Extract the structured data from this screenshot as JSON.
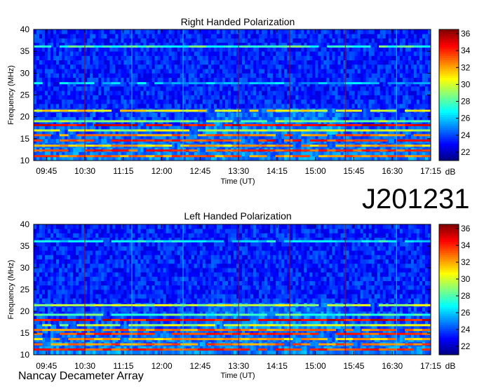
{
  "observation_id": "J201231",
  "observatory": "Nancay Decameter Array",
  "colors": {
    "background": "#00208c",
    "accent_red": "#b00000",
    "accent_yellow": "#ffe800",
    "accent_cyan": "#20c8ff"
  },
  "chart_data": [
    {
      "type": "heatmap",
      "title": "Right Handed Polarization",
      "xlabel": "Time (UT)",
      "ylabel": "Frequency (MHz)",
      "x_ticks": [
        "09:45",
        "10:30",
        "11:15",
        "12:00",
        "12:45",
        "13:30",
        "14:15",
        "15:00",
        "15:45",
        "16:30",
        "17:15"
      ],
      "y_ticks": [
        10,
        15,
        20,
        25,
        30,
        35,
        40
      ],
      "xlim": [
        "09:30",
        "17:15"
      ],
      "ylim": [
        10,
        40
      ],
      "colorbar": {
        "label": "dB",
        "ticks": [
          22,
          24,
          26,
          28,
          30,
          32,
          34,
          36
        ],
        "range": [
          21,
          36.5
        ]
      },
      "horizontal_bands": [
        {
          "freq": 11.0,
          "level": 34
        },
        {
          "freq": 12.3,
          "level": 35
        },
        {
          "freq": 13.4,
          "level": 33
        },
        {
          "freq": 14.6,
          "level": 35
        },
        {
          "freq": 15.8,
          "level": 34
        },
        {
          "freq": 16.9,
          "level": 31
        },
        {
          "freq": 18.1,
          "level": 36
        },
        {
          "freq": 19.0,
          "level": 30
        },
        {
          "freq": 21.4,
          "level": 32
        },
        {
          "freq": 27.7,
          "level": 27
        },
        {
          "freq": 36.1,
          "level": 29
        }
      ],
      "vertical_lines": [
        {
          "time": "10:30",
          "color": "red"
        },
        {
          "time": "11:25",
          "color": "cyan"
        },
        {
          "time": "12:25",
          "color": "cyan"
        },
        {
          "time": "13:30",
          "color": "red"
        },
        {
          "time": "14:30",
          "color": "red"
        },
        {
          "time": "15:35",
          "color": "red"
        },
        {
          "time": "16:35",
          "color": "cyan"
        }
      ]
    },
    {
      "type": "heatmap",
      "title": "Left Handed Polarization",
      "xlabel": "Time (UT)",
      "ylabel": "Frequency (MHz)",
      "x_ticks": [
        "09:45",
        "10:30",
        "11:15",
        "12:00",
        "12:45",
        "13:30",
        "14:15",
        "15:00",
        "15:45",
        "16:30",
        "17:15"
      ],
      "y_ticks": [
        10,
        15,
        20,
        25,
        30,
        35,
        40
      ],
      "xlim": [
        "09:30",
        "17:15"
      ],
      "ylim": [
        10,
        40
      ],
      "colorbar": {
        "label": "dB",
        "ticks": [
          22,
          24,
          26,
          28,
          30,
          32,
          34,
          36
        ],
        "range": [
          21,
          36.5
        ]
      },
      "horizontal_bands": [
        {
          "freq": 11.2,
          "level": 35
        },
        {
          "freq": 12.4,
          "level": 34
        },
        {
          "freq": 13.6,
          "level": 33
        },
        {
          "freq": 14.8,
          "level": 35
        },
        {
          "freq": 15.7,
          "level": 34
        },
        {
          "freq": 16.8,
          "level": 31
        },
        {
          "freq": 18.0,
          "level": 36
        },
        {
          "freq": 19.2,
          "level": 29
        },
        {
          "freq": 21.4,
          "level": 31
        },
        {
          "freq": 36.1,
          "level": 28
        }
      ],
      "vertical_lines": [
        {
          "time": "10:30",
          "color": "red"
        },
        {
          "time": "11:25",
          "color": "cyan"
        },
        {
          "time": "12:25",
          "color": "cyan"
        },
        {
          "time": "13:30",
          "color": "red"
        },
        {
          "time": "14:30",
          "color": "red"
        },
        {
          "time": "15:35",
          "color": "red"
        },
        {
          "time": "16:35",
          "color": "cyan"
        }
      ]
    }
  ]
}
